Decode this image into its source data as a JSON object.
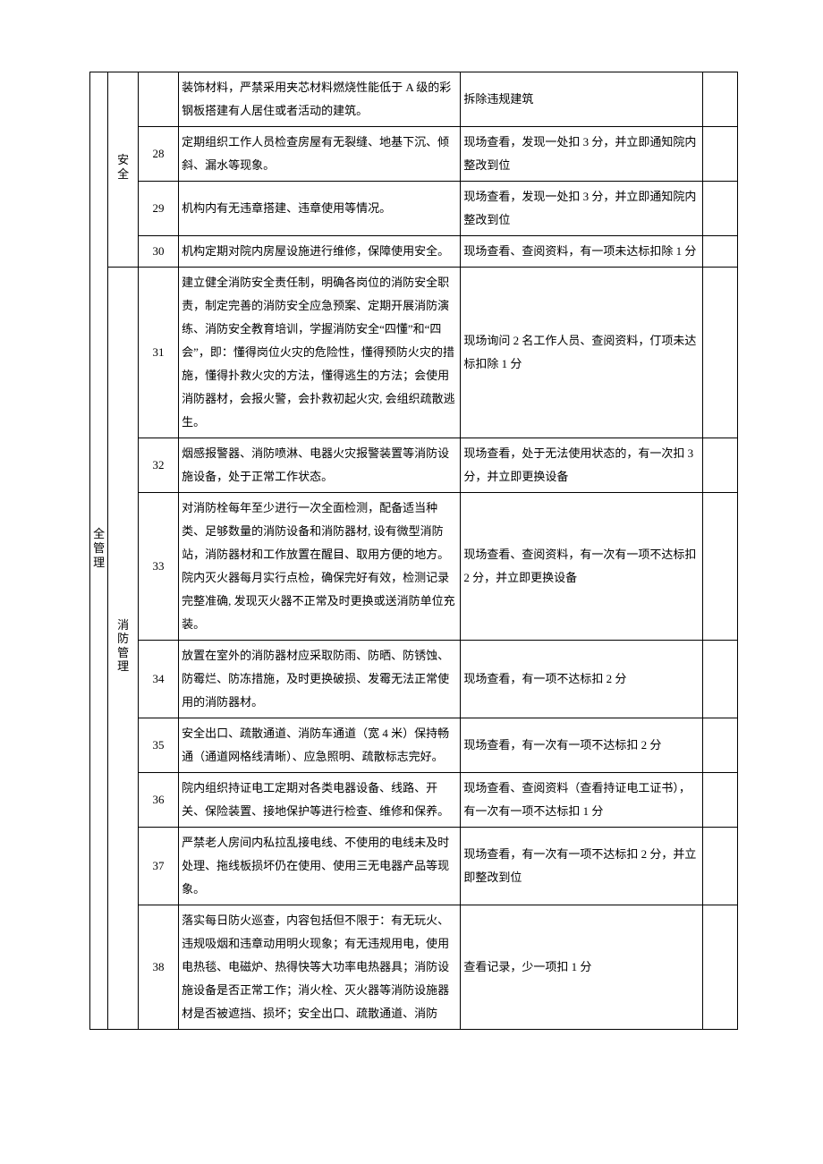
{
  "category_main": "全管理",
  "category_sub_building": "安全",
  "category_sub_fire": "消防管理",
  "rows": [
    {
      "no": "",
      "req": "装饰材料，严禁采用夹芯材料燃烧性能低于 A 级的彩钢板搭建有人居住或者活动的建筑。",
      "check": "拆除违规建筑",
      "score": ""
    },
    {
      "no": "28",
      "req": "定期组织工作人员检查房屋有无裂缝、地基下沉、倾斜、漏水等现象。",
      "check": "现场查看，发现一处扣 3 分，并立即通知院内整改到位",
      "score": ""
    },
    {
      "no": "29",
      "req": "机构内有无违章搭建、违章使用等情况。",
      "check": "现场查看，发现一处扣 3 分，并立即通知院内整改到位",
      "score": ""
    },
    {
      "no": "30",
      "req": "机构定期对院内房屋设施进行维修，保障使用安全。",
      "check": "现场查看、查阅资料，有一项未达标扣除 1 分",
      "score": ""
    },
    {
      "no": "31",
      "req": "建立健全消防安全责任制，明确各岗位的消防安全职责，制定完善的消防安全应急预案、定期开展消防演练、消防安全教育培训，学握消防安全“四懂”和“四会”，即：懂得岗位火灾的危险性，懂得预防火灾的措施，懂得扑救火灾的方法，懂得逃生的方法；会使用消防器材，会报火警，会扑救初起火灾, 会组织疏散逃生。",
      "check": "现场询问 2 名工作人员、查阅资料，仃项未达标扣除 1 分",
      "score": ""
    },
    {
      "no": "32",
      "req": "烟感报警器、消防喷淋、电器火灾报警装置等消防设施设备，处于正常工作状态。",
      "check": "现场查看，处于无法使用状态的，有一次扣 3 分，并立即更换设备",
      "score": ""
    },
    {
      "no": "33",
      "req": "对消防栓每年至少进行一次全面检测，配备适当种类、足够数量的消防设备和消防器材, 设有微型消防站，消防器材和工作放置在醒目、取用方便的地方。院内灭火器每月实行点检，确保完好有效，检测记录完整准确, 发现灭火器不正常及时更换或送消防单位充装。",
      "check": "现场查看、查阅资料，有一次有一项不达标扣 2 分，并立即更换设备",
      "score": ""
    },
    {
      "no": "34",
      "req": "放置在室外的消防器材应采取防雨、防晒、防锈蚀、防霉烂、防冻措施，及时更换破损、发霉无法正常使用的消防器材。",
      "check": "现场查看，有一项不达标扣 2 分",
      "score": ""
    },
    {
      "no": "35",
      "req": "安全出口、疏散通道、消防车通道（宽 4 米）保持畅通（通道网格线清晰）、应急照明、疏散标志完好。",
      "check": "现场查看，有一次有一项不达标扣 2 分",
      "score": ""
    },
    {
      "no": "36",
      "req": "院内组织持证电工定期对各类电器设备、线路、开关、保险装置、接地保护等进行检查、维修和保养。",
      "check": "现场查看、查阅资料（查看持证电工证书），有一次有一项不达标扣 1 分",
      "score": ""
    },
    {
      "no": "37",
      "req": "严禁老人房间内私拉乱接电线、不使用的电线未及时处理、拖线板损坏仍在使用、使用三无电器产品等现象。",
      "check": "现场查看，有一次有一项不达标扣 2 分，并立即整改到位",
      "score": ""
    },
    {
      "no": "38",
      "req": "落实每日防火巡查，内容包括但不限于：有无玩火、违规吸烟和违章动用明火现象；有无违规用电，使用电热毯、电磁炉、热得快等大功率电热器具；消防设施设备是否正常工作；消火栓、灭火器等消防设施器材是否被遮挡、损坏；安全出口、疏散通道、消防",
      "check": "查看记录，少一项扣 1 分",
      "score": ""
    }
  ]
}
